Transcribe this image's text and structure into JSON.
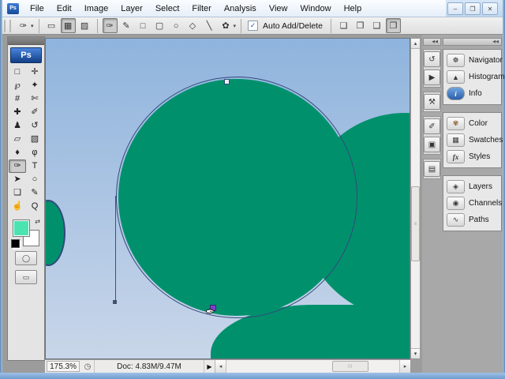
{
  "app": {
    "badge": "Ps"
  },
  "window_controls": {
    "minimize": "–",
    "restore": "❐",
    "close": "✕"
  },
  "menu": {
    "items": [
      "File",
      "Edit",
      "Image",
      "Layer",
      "Select",
      "Filter",
      "Analysis",
      "View",
      "Window",
      "Help"
    ]
  },
  "options_bar": {
    "tool_glyph": "✑",
    "dropdown_glyph": "▾",
    "modes": [
      {
        "name": "shape-layers",
        "glyph": "▭"
      },
      {
        "name": "paths",
        "glyph": "▦"
      },
      {
        "name": "fill-pixels",
        "glyph": "▨"
      }
    ],
    "shape_tools": [
      {
        "name": "pen",
        "glyph": "✑"
      },
      {
        "name": "freeform-pen",
        "glyph": "✎"
      },
      {
        "name": "rectangle",
        "glyph": "□"
      },
      {
        "name": "rounded-rectangle",
        "glyph": "▢"
      },
      {
        "name": "ellipse",
        "glyph": "○"
      },
      {
        "name": "polygon",
        "glyph": "◇"
      },
      {
        "name": "line",
        "glyph": "╲"
      },
      {
        "name": "custom-shape",
        "glyph": "✿"
      }
    ],
    "auto_add_delete": {
      "label": "Auto Add/Delete",
      "checked": true,
      "check_glyph": "✓"
    },
    "path_ops": [
      {
        "name": "add-to-path-area",
        "glyph": "❏"
      },
      {
        "name": "subtract-from-path-area",
        "glyph": "❐"
      },
      {
        "name": "intersect-path-areas",
        "glyph": "❑"
      },
      {
        "name": "exclude-overlapping-path-areas",
        "glyph": "❒"
      }
    ]
  },
  "toolbox": {
    "logo": "Ps",
    "tools": [
      {
        "name": "rectangular-marquee",
        "glyph": "□"
      },
      {
        "name": "move",
        "glyph": "✛"
      },
      {
        "name": "lasso",
        "glyph": "℘"
      },
      {
        "name": "magic-wand",
        "glyph": "✦"
      },
      {
        "name": "crop",
        "glyph": "#"
      },
      {
        "name": "slice",
        "glyph": "✄"
      },
      {
        "name": "healing-brush",
        "glyph": "✚"
      },
      {
        "name": "brush",
        "glyph": "✐"
      },
      {
        "name": "clone-stamp",
        "glyph": "♟"
      },
      {
        "name": "history-brush",
        "glyph": "↺"
      },
      {
        "name": "eraser",
        "glyph": "▱"
      },
      {
        "name": "gradient",
        "glyph": "▧"
      },
      {
        "name": "blur",
        "glyph": "♦"
      },
      {
        "name": "dodge",
        "glyph": "φ"
      },
      {
        "name": "pen",
        "glyph": "✑",
        "selected": true
      },
      {
        "name": "type",
        "glyph": "T"
      },
      {
        "name": "path-selection",
        "glyph": "➤"
      },
      {
        "name": "ellipse-shape",
        "glyph": "○"
      },
      {
        "name": "notes",
        "glyph": "❏"
      },
      {
        "name": "eyedropper",
        "glyph": "✎"
      },
      {
        "name": "hand",
        "glyph": "☝"
      },
      {
        "name": "zoom",
        "glyph": "Q"
      }
    ],
    "color_wells": {
      "foreground": "#4BE4B0",
      "background": "#FFFFFF",
      "swap_glyph": "⇄"
    },
    "quick_mask_glyph": "◯",
    "screen_mode_glyph": "▭"
  },
  "dock": {
    "collapse_glyph": "◀◀",
    "icon_buttons": [
      {
        "name": "history",
        "glyph": "↺"
      },
      {
        "name": "actions",
        "glyph": "▶"
      },
      {
        "name": "tool-presets",
        "glyph": "⚒"
      },
      {
        "name": "brushes",
        "glyph": "✐"
      },
      {
        "name": "clone-source",
        "glyph": "▣"
      },
      {
        "name": "layer-comps",
        "glyph": "▤"
      }
    ],
    "groups": [
      {
        "items": [
          {
            "label": "Navigator",
            "glyph": "☸"
          },
          {
            "label": "Histogram",
            "glyph": "▲"
          },
          {
            "label": "Info",
            "glyph": "i"
          }
        ]
      },
      {
        "items": [
          {
            "label": "Color",
            "glyph": "✾"
          },
          {
            "label": "Swatches",
            "glyph": "▦"
          },
          {
            "label": "Styles",
            "glyph": "fx"
          }
        ]
      },
      {
        "items": [
          {
            "label": "Layers",
            "glyph": "◈"
          },
          {
            "label": "Channels",
            "glyph": "◉"
          },
          {
            "label": "Paths",
            "glyph": "∿"
          }
        ]
      }
    ]
  },
  "status_bar": {
    "zoom_value": "175.3%",
    "clock_glyph": "◷",
    "doc_info": "Doc: 4.83M/9.47M",
    "flyout_glyph": "▶"
  },
  "scrollbars": {
    "up": "▴",
    "down": "▾",
    "left": "◂",
    "right": "▸",
    "h_grip": "|||",
    "v_grip": "≡"
  },
  "canvas": {
    "cursor_glyph": "✒",
    "colors": {
      "sky_top": "#8FB4DD",
      "sky_bottom": "#C9D6E9",
      "shape_green": "#00916C",
      "path_outline": "#31497B",
      "selected_anchor": "#7B3FC8"
    }
  }
}
